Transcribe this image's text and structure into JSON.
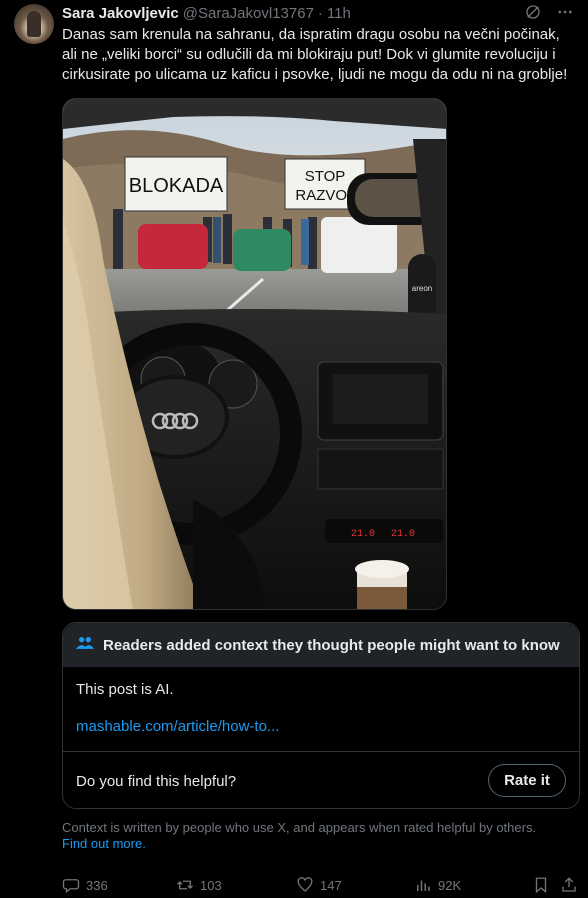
{
  "tweet": {
    "author_name": "Sara Jakovljevic",
    "handle": "@SaraJakovl13767",
    "separator": "·",
    "time": "11h",
    "text": "Danas sam krenula na sahranu, da ispratim dragu osobu na večni počinak, ali ne „veliki borci“ su odlučili da mi blokiraju put! Dok vi glumite revoluciju i cirkusirate po ulicama uz kaficu i psovke, ljudi ne mogu da odu ni na groblje!"
  },
  "media": {
    "banner_left": "BLOKADA",
    "banner_right_line1": "STOP",
    "banner_right_line2": "RAZVOJ",
    "car_display_left": "21.0",
    "car_display_right": "21.0",
    "ornament_text": "areon"
  },
  "community_note": {
    "header": "Readers added context they thought people might want to know",
    "text": "This post is AI.",
    "link": "mashable.com/article/how-to...",
    "helpful_question": "Do you find this helpful?",
    "rate_button": "Rate it"
  },
  "context_footer": {
    "text": "Context is written by people who use X, and appears when rated helpful by others.",
    "link": "Find out more."
  },
  "actions": {
    "replies": "336",
    "reposts": "103",
    "likes": "147",
    "views": "92K"
  },
  "icons": [
    "grok-icon",
    "more-icon",
    "people-icon",
    "reply-icon",
    "repost-icon",
    "like-icon",
    "views-icon",
    "bookmark-icon",
    "share-icon"
  ],
  "colors": {
    "accent": "#1d9bf0",
    "muted": "#71767b",
    "text": "#e7e9ea",
    "background": "#000000"
  }
}
